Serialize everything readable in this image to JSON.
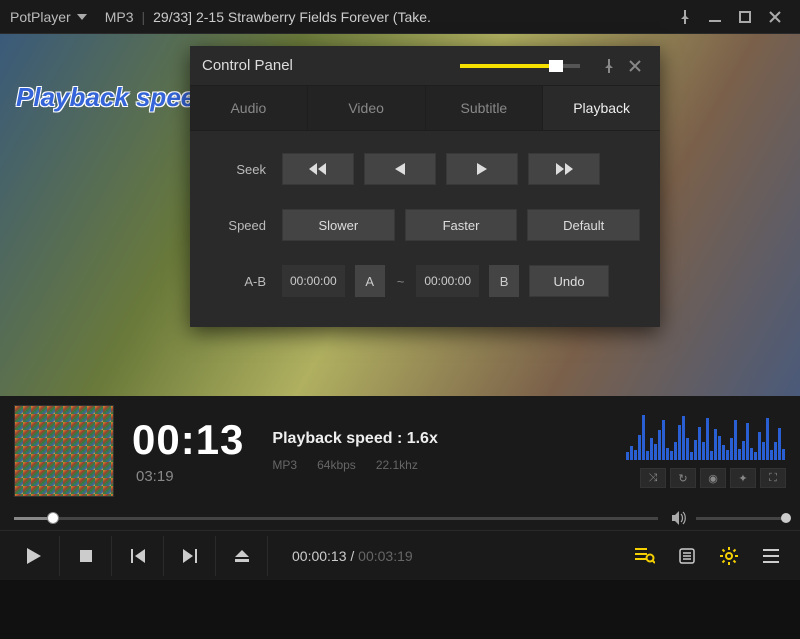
{
  "titlebar": {
    "app_name": "PotPlayer",
    "format": "MP3",
    "track": "29/33] 2-15 Strawberry Fields Forever (Take."
  },
  "overlay": "Playback spee",
  "panel": {
    "title": "Control Panel",
    "tabs": {
      "audio": "Audio",
      "video": "Video",
      "subtitle": "Subtitle",
      "playback": "Playback"
    },
    "seek_label": "Seek",
    "speed_label": "Speed",
    "speed_buttons": {
      "slower": "Slower",
      "faster": "Faster",
      "default": "Default"
    },
    "ab_label": "A-B",
    "ab": {
      "a_time": "00:00:00",
      "a_lbl": "A",
      "sep": "~",
      "b_time": "00:00:00",
      "b_lbl": "B",
      "undo": "Undo"
    }
  },
  "info": {
    "current_time": "00:13",
    "total_time": "03:19",
    "speed_text": "Playback speed : 1.6x",
    "codec": "MP3",
    "bitrate": "64kbps",
    "samplerate": "22.1khz"
  },
  "bottom": {
    "elapsed": "00:00:13",
    "sep": " / ",
    "total": "00:03:19"
  },
  "visualizer_heights": [
    8,
    14,
    10,
    25,
    45,
    9,
    22,
    16,
    30,
    40,
    12,
    9,
    18,
    35,
    44,
    22,
    8,
    20,
    33,
    18,
    42,
    9,
    31,
    24,
    15,
    10,
    22,
    40,
    11,
    19,
    37,
    12,
    8,
    28,
    18,
    42,
    10,
    18,
    32,
    11
  ]
}
